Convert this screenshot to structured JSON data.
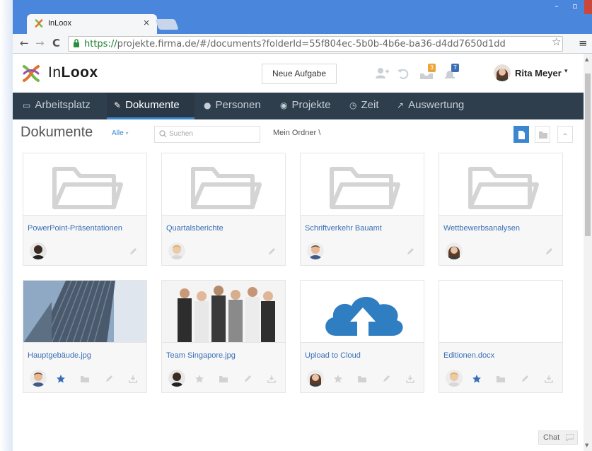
{
  "browser": {
    "tab_title": "InLoox",
    "tab_close": "×",
    "window_controls": {
      "minimize": "–",
      "maximize": "▫",
      "close": "×"
    },
    "nav": {
      "back": "←",
      "forward": "→",
      "reload": "C"
    },
    "url_secure": "https://",
    "url_rest": "projekte.firma.de/#/documents?folderId=55f804ec-5b0b-4b6e-ba36-d4dd7650d1dd",
    "bookmark": "☆",
    "menu": "≡"
  },
  "app": {
    "logo_light": "In",
    "logo_bold": "Loox",
    "new_task_label": "Neue Aufgabe",
    "toolbar_badges": {
      "mail": "3",
      "notifications": "7"
    },
    "user_name": "Rita Meyer",
    "user_caret": "▾",
    "colors": {
      "accent": "#3a87d0",
      "nav_bg": "#2f3e4d",
      "mail_badge": "#f0a33a",
      "notif_badge": "#3a6fb5",
      "link": "#3a6fb5"
    }
  },
  "navbar": {
    "items": [
      {
        "label": "Arbeitsplatz",
        "icon": "monitor-icon",
        "glyph": "▭"
      },
      {
        "label": "Dokumente",
        "icon": "paperclip-icon",
        "glyph": "✎"
      },
      {
        "label": "Personen",
        "icon": "person-icon",
        "glyph": "●"
      },
      {
        "label": "Projekte",
        "icon": "target-icon",
        "glyph": "◉"
      },
      {
        "label": "Zeit",
        "icon": "clock-icon",
        "glyph": "◷"
      },
      {
        "label": "Auswertung",
        "icon": "chart-icon",
        "glyph": "↗"
      }
    ],
    "active_index": 1
  },
  "subbar": {
    "title": "Dokumente",
    "filter": "Alle",
    "filter_caret": "▾",
    "search_placeholder": "Suchen",
    "breadcrumb": "Mein Ordner  \\"
  },
  "documents": [
    {
      "name": "PowerPoint-Präsentationen",
      "type": "folder",
      "starred": false
    },
    {
      "name": "Quartalsberichte",
      "type": "folder",
      "starred": false
    },
    {
      "name": "Schriftverkehr Bauamt",
      "type": "folder",
      "starred": false
    },
    {
      "name": "Wettbewerbsanalysen",
      "type": "folder",
      "starred": false
    },
    {
      "name": "Hauptgebäude.jpg",
      "type": "image-building",
      "starred": true
    },
    {
      "name": "Team Singapore.jpg",
      "type": "image-team",
      "starred": false
    },
    {
      "name": "Upload to Cloud",
      "type": "cloud-upload",
      "starred": false
    },
    {
      "name": "Editionen.docx",
      "type": "docx",
      "starred": true
    }
  ],
  "chat": {
    "label": "Chat"
  }
}
